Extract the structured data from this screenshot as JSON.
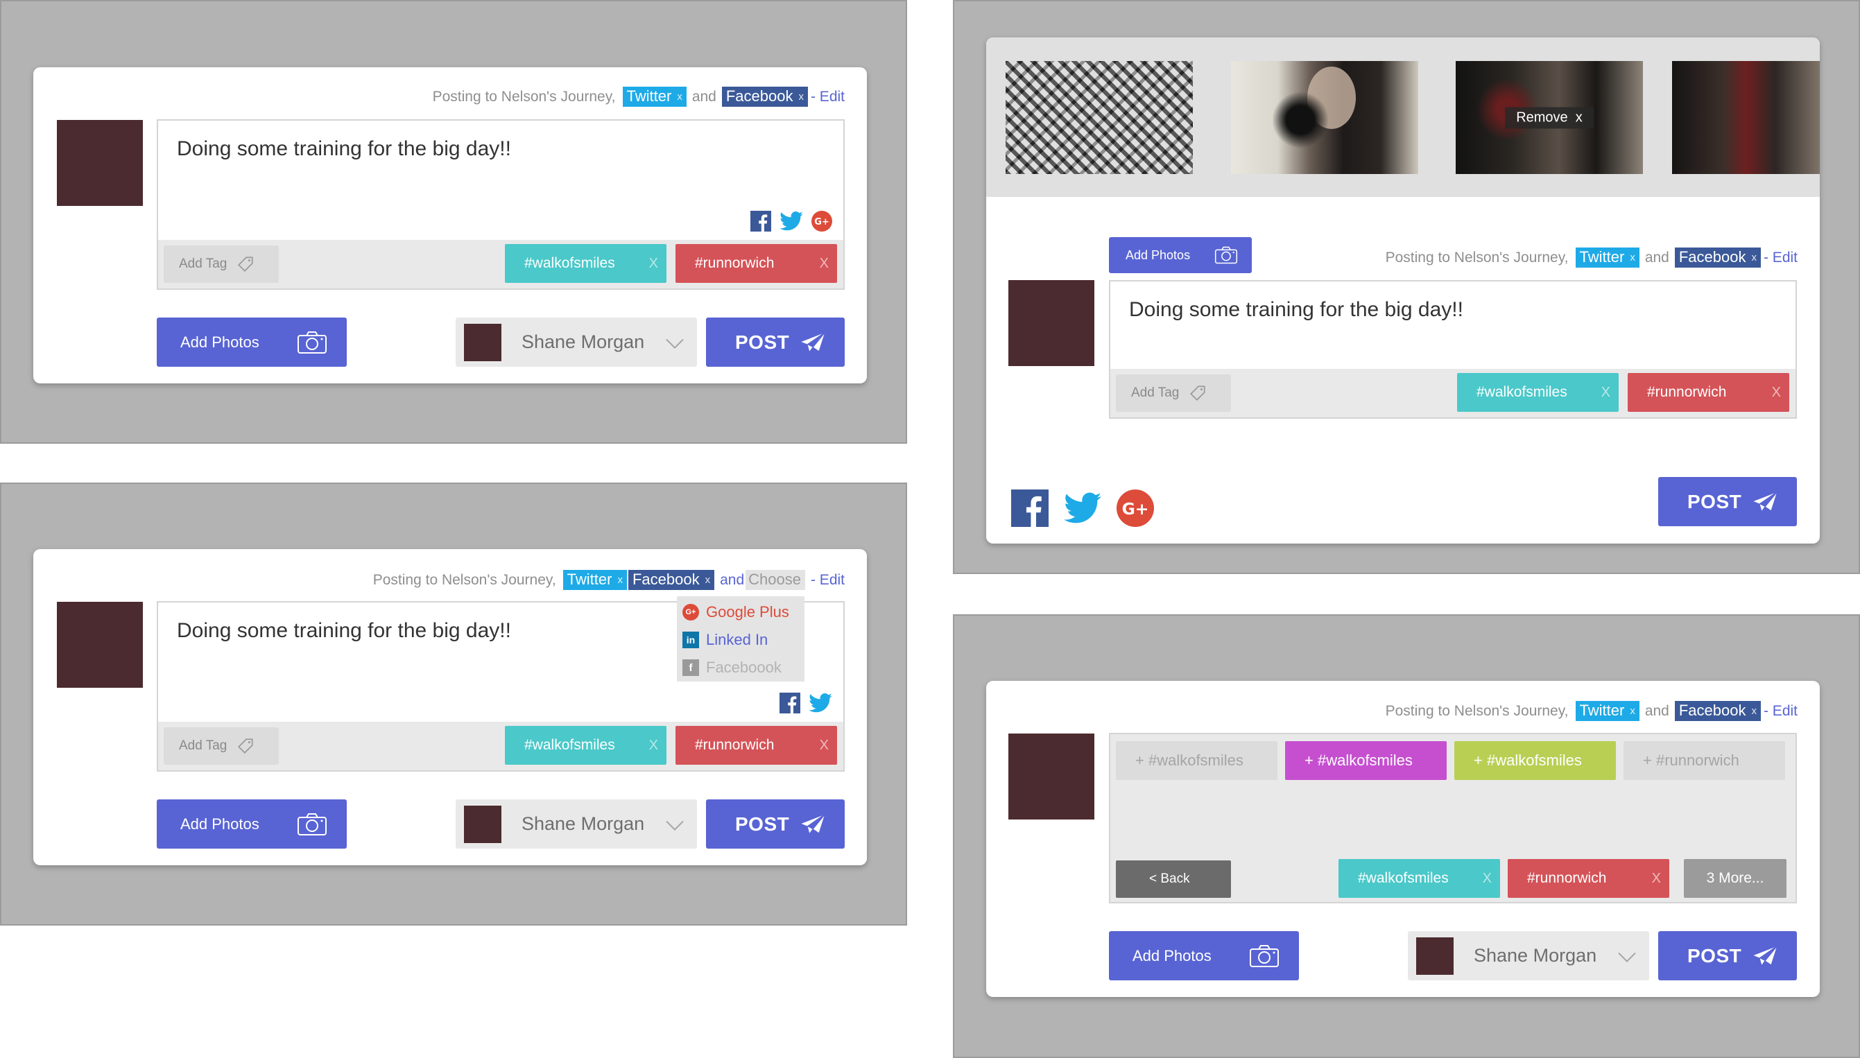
{
  "posting": {
    "prefix": "Posting to Nelson's Journey,",
    "twitter": "Twitter",
    "facebook": "Facebook",
    "and": "and",
    "edit": "- Edit",
    "remove_x": "x"
  },
  "composer": {
    "text": "Doing some training for the big day!!",
    "add_tag": "Add Tag",
    "tags": [
      "#walkofsmiles",
      "#runnorwich"
    ],
    "tag_remove": "X"
  },
  "actions": {
    "add_photos": "Add Photos",
    "account_name": "Shane Morgan",
    "post": "POST"
  },
  "dropdown": {
    "choose": "Choose",
    "options": [
      "Google Plus",
      "Linked In",
      "Faceboook"
    ]
  },
  "photos": {
    "remove": "Remove",
    "remove_x": "x"
  },
  "suggestions": {
    "items": [
      "+ #walkofsmiles",
      "+ #walkofsmiles",
      "+ #walkofsmiles",
      "+ #runnorwich"
    ],
    "back": "< Back",
    "more": "3 More..."
  },
  "icons": [
    "facebook-icon",
    "twitter-icon",
    "google-plus-icon",
    "camera-icon",
    "tag-icon",
    "send-icon",
    "chevron-down-icon",
    "linkedin-icon"
  ],
  "colors": {
    "accent": "#5864d3",
    "twitter": "#1eaae7",
    "facebook": "#3b5998",
    "tag_teal": "#4bc8c9",
    "tag_red": "#d45358",
    "google": "#dd4b39",
    "suggest_magenta": "#c64fd0",
    "suggest_green": "#b8cf54",
    "avatar": "#4b2b2f"
  }
}
